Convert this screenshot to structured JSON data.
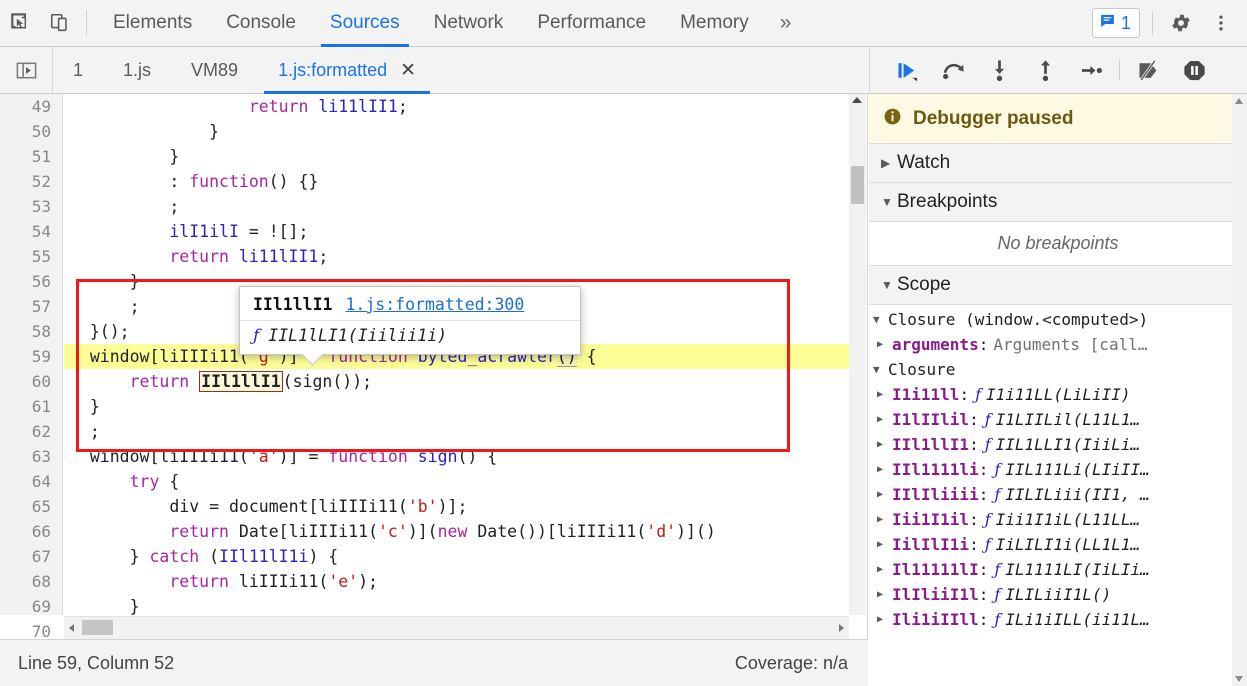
{
  "topbar": {
    "inspect_icon": "inspect-cursor-icon",
    "device_icon": "device-toolbar-icon",
    "tabs": [
      {
        "label": "Elements",
        "active": false
      },
      {
        "label": "Console",
        "active": false
      },
      {
        "label": "Sources",
        "active": true
      },
      {
        "label": "Network",
        "active": false
      },
      {
        "label": "Performance",
        "active": false
      },
      {
        "label": "Memory",
        "active": false
      }
    ],
    "more_tabs": "»",
    "message_count": "1",
    "message_icon": "message-bubble-icon",
    "settings_icon": "gear-icon",
    "more_icon": "kebab-menu-icon",
    "accent_color": "#1a73e8"
  },
  "subbar": {
    "navigator_icon": "show-navigator-icon",
    "tabs": [
      {
        "label": "1",
        "active": false,
        "closable": false
      },
      {
        "label": "1.js",
        "active": false,
        "closable": false
      },
      {
        "label": "VM89",
        "active": false,
        "closable": false
      },
      {
        "label": "1.js:formatted",
        "active": true,
        "closable": true
      }
    ],
    "close_glyph": "✕",
    "panel_toggle_icon": "show-debugger-sidebar-icon"
  },
  "debugger_toolbar": {
    "buttons": [
      {
        "name": "resume-script-execution",
        "icon": "resume-icon"
      },
      {
        "name": "step-over-next-function-call",
        "icon": "step-over-icon"
      },
      {
        "name": "step-into-next-function-call",
        "icon": "step-into-icon"
      },
      {
        "name": "step-out-of-current-function",
        "icon": "step-out-icon"
      },
      {
        "name": "step",
        "icon": "step-icon"
      },
      {
        "name": "deactivate-breakpoints",
        "icon": "deactivate-breakpoints-icon"
      },
      {
        "name": "pause-on-exceptions",
        "icon": "pause-on-exceptions-icon"
      }
    ]
  },
  "editor": {
    "first_line_number": 49,
    "highlighted_line": 59,
    "lines": [
      {
        "n": 49,
        "html": "                  <span class=\"tok-kw\">return</span> <span class=\"tok-var\">li11lII1</span>;"
      },
      {
        "n": 50,
        "html": "              }"
      },
      {
        "n": 51,
        "html": "          }"
      },
      {
        "n": 52,
        "html": "          : <span class=\"tok-kw\">function</span>() {}"
      },
      {
        "n": 53,
        "html": "          ;"
      },
      {
        "n": 54,
        "html": "          <span class=\"tok-var\">ilI1ilI</span> = ![];"
      },
      {
        "n": 55,
        "html": "          <span class=\"tok-kw\">return</span> <span class=\"tok-var\">li11lII1</span>;"
      },
      {
        "n": 56,
        "html": "      }"
      },
      {
        "n": 57,
        "html": "      ;"
      },
      {
        "n": 58,
        "html": "  }();"
      },
      {
        "n": 59,
        "html": "  <span class=\"tok-plain\">window</span>[<span class=\"tok-plain\">liIIIi11</span>(<span class=\"tok-str\">'g'</span>)] = <span class=\"tok-kw\">function</span> <span class=\"tok-fn\">byted_acrawler</span><span class=\"tok-sel\">()</span> {"
      },
      {
        "n": 60,
        "html": "      <span class=\"tok-kw\">return</span> <span class=\"idbox\">IIl1llI1</span>(<span class=\"tok-plain\">sign</span>());"
      },
      {
        "n": 61,
        "html": "  }"
      },
      {
        "n": 62,
        "html": "  ;"
      },
      {
        "n": 63,
        "html": "  <span class=\"tok-plain\">window</span>[<span class=\"tok-plain\">liIIIi11</span>(<span class=\"tok-str\">'a'</span>)] = <span class=\"tok-kw\">function</span> <span class=\"tok-fn\">sign</span>() {"
      },
      {
        "n": 64,
        "html": "      <span class=\"tok-kw\">try</span> {"
      },
      {
        "n": 65,
        "html": "          <span class=\"tok-plain\">div</span> = <span class=\"tok-plain\">document</span>[<span class=\"tok-plain\">liIIIi11</span>(<span class=\"tok-str\">'b'</span>)];"
      },
      {
        "n": 66,
        "html": "          <span class=\"tok-kw\">return</span> <span class=\"tok-plain\">Date</span>[<span class=\"tok-plain\">liIIIi11</span>(<span class=\"tok-str\">'c'</span>)](<span class=\"tok-kw\">new</span> <span class=\"tok-plain\">Date</span>())[<span class=\"tok-plain\">liIIIi11</span>(<span class=\"tok-str\">'d'</span>)]()"
      },
      {
        "n": 67,
        "html": "      } <span class=\"tok-kw\">catch</span> (<span class=\"tok-var\">IIl11lI1i</span>) {"
      },
      {
        "n": 68,
        "html": "          <span class=\"tok-kw\">return</span> <span class=\"tok-plain\">liIIIi11</span>(<span class=\"tok-str\">'e'</span>);"
      },
      {
        "n": 69,
        "html": "      }"
      },
      {
        "n": 70,
        "html": ""
      }
    ]
  },
  "popover": {
    "name": "IIl1llI1",
    "link": "1.js:formatted:300",
    "f_glyph": "ƒ",
    "signature": "IIL1lLI1(Iiilii1i)"
  },
  "sidebar": {
    "paused_text": "Debugger paused",
    "paused_icon": "info-icon",
    "watch": {
      "label": "Watch",
      "expanded": false
    },
    "breakpoints": {
      "label": "Breakpoints",
      "expanded": true,
      "empty_text": "No breakpoints"
    },
    "scope": {
      "label": "Scope",
      "expanded": true
    },
    "scope_entries": [
      {
        "type": "closure",
        "caret": "▼",
        "title": "Closure (window.<computed>)",
        "indent": 0
      },
      {
        "type": "prop",
        "caret": "▶",
        "key": "arguments",
        "value": "Arguments [call…",
        "indent": 1
      },
      {
        "type": "closure",
        "caret": "▼",
        "title": "Closure",
        "indent": 0
      },
      {
        "type": "fn",
        "caret": "▶",
        "key": "I1i11ll",
        "sig": "I1i11LL(LiLiII)",
        "indent": 1
      },
      {
        "type": "fn",
        "caret": "▶",
        "key": "I1lIIlil",
        "sig": "I1LIILil(L11L1…",
        "indent": 1
      },
      {
        "type": "fn",
        "caret": "▶",
        "key": "IIl1llI1",
        "sig": "IIL1LLI1(IiiLi…",
        "indent": 1
      },
      {
        "type": "fn",
        "caret": "▶",
        "key": "IIl1111li",
        "sig": "IIL111Li(LIiII…",
        "indent": 1
      },
      {
        "type": "fn",
        "caret": "▶",
        "key": "IIlIliiii",
        "sig": "IILILiii(II1, …",
        "indent": 1
      },
      {
        "type": "fn",
        "caret": "▶",
        "key": "Iii1I1il",
        "sig": "Iii1I1iL(L11LL…",
        "indent": 1
      },
      {
        "type": "fn",
        "caret": "▶",
        "key": "IilIlI1i",
        "sig": "IiLILI1i(LL1L1…",
        "indent": 1
      },
      {
        "type": "fn",
        "caret": "▶",
        "key": "Il11111lI",
        "sig": "IL1111LI(IiLIi…",
        "indent": 1
      },
      {
        "type": "fn",
        "caret": "▶",
        "key": "IlIliiI1l",
        "sig": "ILILiiI1L()",
        "indent": 1
      },
      {
        "type": "fn",
        "caret": "▶",
        "key": "Ili1iIIll",
        "sig": "ILi1iILL(ii11L…",
        "indent": 1
      }
    ]
  },
  "statusbar": {
    "position": "Line 59, Column 52",
    "coverage": "Coverage: n/a"
  },
  "colors": {
    "accent": "#1a73e8",
    "highlight_line": "#fdfd96",
    "annotation_red": "#f01818",
    "paused_banner": "#fdf9e2"
  }
}
